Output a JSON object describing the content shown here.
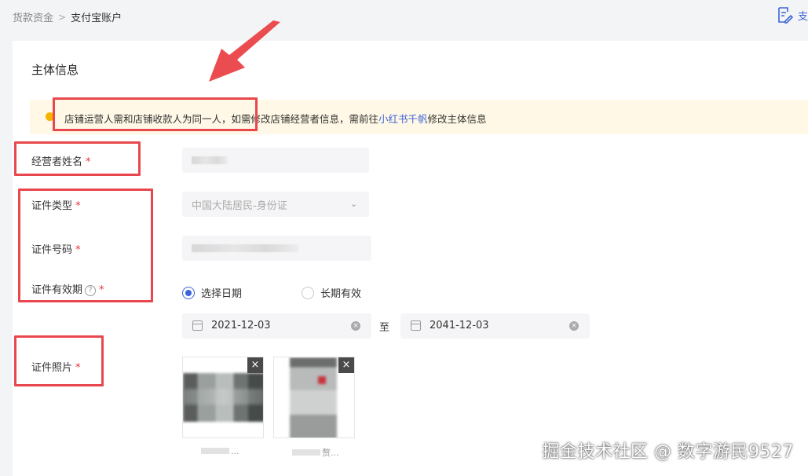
{
  "breadcrumb": {
    "parent": "货款资金",
    "separator": ">",
    "current": "支付宝账户"
  },
  "top_action": {
    "label": "支",
    "icon": "edit-document-icon"
  },
  "section": {
    "title": "主体信息"
  },
  "notice": {
    "text_before": "店铺运营人需和店铺收款人为同一人，如需修改店铺经营者信息，需前往",
    "link": "小红书千帆",
    "text_after": "修改主体信息"
  },
  "form": {
    "operator_name": {
      "label": "经营者姓名",
      "required": "*"
    },
    "id_type": {
      "label": "证件类型",
      "required": "*",
      "value": "中国大陆居民-身份证"
    },
    "id_number": {
      "label": "证件号码",
      "required": "*"
    },
    "id_validity": {
      "label": "证件有效期",
      "help": "?",
      "required": "*",
      "options": [
        {
          "label": "选择日期",
          "selected": true
        },
        {
          "label": "长期有效",
          "selected": false
        }
      ],
      "start_date": "2021-12-03",
      "to": "至",
      "end_date": "2041-12-03"
    },
    "id_photo": {
      "label": "证件照片",
      "required": "*",
      "files": [
        {
          "name": "..."
        },
        {
          "name": "赘..."
        }
      ]
    }
  },
  "watermark": "掘金技术社区 @ 数字游民9527",
  "colors": {
    "accent": "#3c64d8",
    "highlight_red": "#e8484d",
    "notice_bg": "#fff8e6",
    "required": "#e3343c"
  }
}
